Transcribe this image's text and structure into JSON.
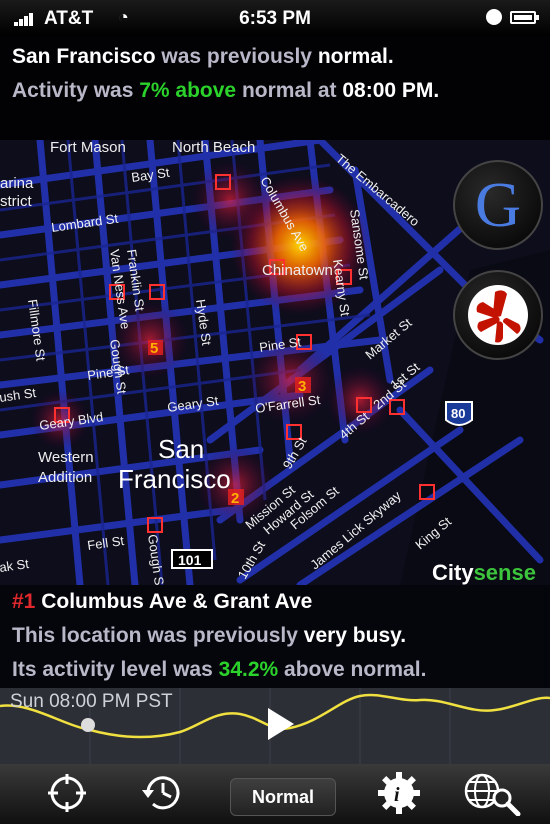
{
  "status_bar": {
    "carrier": "AT&T",
    "time": "6:53 PM"
  },
  "banner": {
    "line1_city": "San Francisco",
    "line1_mid": "was previously",
    "line1_state": "normal.",
    "line2_pre": "Activity was",
    "line2_value": "7% above",
    "line2_mid": "normal at",
    "line2_time": "08:00 PM."
  },
  "map": {
    "neighborhoods": [
      "Fort Mason",
      "North Beach",
      "Chinatown",
      "Western",
      "Addition",
      "arina",
      "strict"
    ],
    "city_label_1": "San",
    "city_label_2": "Francisco",
    "streets": [
      "Bay St",
      "Lombard St",
      "Van Ness Ave",
      "Franklin St",
      "Gough St",
      "Hyde St",
      "Pine St",
      "Pine St",
      "Geary St",
      "O'Farrell St",
      "Geary Blvd",
      "ush St",
      "Fillmore St",
      "Columbus Ave",
      "The Embarcadero",
      "Kearny St",
      "Sansome St",
      "Market St",
      "1st St",
      "2nd St",
      "4th St",
      "Mission St",
      "Howard St",
      "Folsom St",
      "James Lick Skyway",
      "King St",
      "Fell St",
      "Gough St",
      "10th St",
      "9th St",
      "ak St"
    ],
    "highway_101": "101",
    "highway_80": "80",
    "hotspot_labels": [
      "5",
      "3",
      "2"
    ],
    "brand_city": "City",
    "brand_sense": "sense",
    "google_letter": "G"
  },
  "detail": {
    "rank": "#1",
    "location": "Columbus Ave & Grant Ave",
    "line2_pre": "This location was previously",
    "line2_state": "very busy.",
    "line3_pre": "Its activity level was",
    "line3_value": "34.2%",
    "line3_post": "above normal."
  },
  "timeline": {
    "label": "Sun 08:00 PM PST",
    "position": 0.16
  },
  "toolbar": {
    "mode_button": "Normal"
  },
  "colors": {
    "accent_green": "#2bd22b",
    "rank_red": "#e0282d",
    "road_blue": "#2a3ad8"
  }
}
